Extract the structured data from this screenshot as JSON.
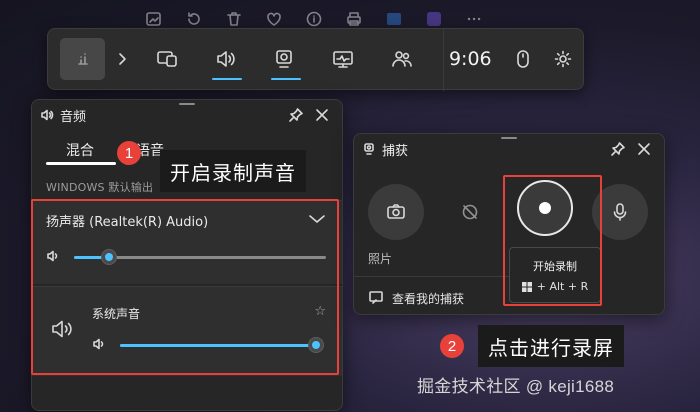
{
  "game_bar": {
    "time": "9:06"
  },
  "audio_panel": {
    "title": "音频",
    "tabs": [
      "混合",
      "语音"
    ],
    "section_header": "WINDOWS 默认输出",
    "device": {
      "name": "扬声器 (Realtek(R) Audio)",
      "volume_fraction": 0.14
    },
    "app": {
      "name": "系统声音",
      "volume_fraction": 1.0
    }
  },
  "capture_panel": {
    "title": "捕获",
    "photo_label": "照片",
    "record_tooltip": {
      "title": "开始录制",
      "shortcut": "+ Alt + R"
    },
    "see_captures": "查看我的捕获"
  },
  "annotations": {
    "step1_number": "1",
    "step1_text": "开启录制声音",
    "step2_number": "2",
    "step2_text": "点击进行录屏"
  },
  "watermark": "掘金技术社区 @ keji1688",
  "colors": {
    "accent": "#4cc2ff",
    "annotation_red": "#e8413a",
    "panel_bg": "#262626"
  }
}
